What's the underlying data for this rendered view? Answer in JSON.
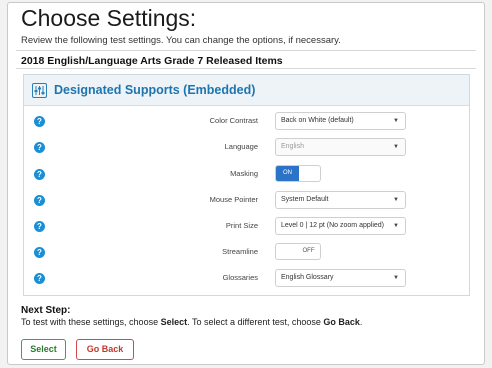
{
  "header": {
    "title": "Choose Settings:",
    "subtitle": "Review the following test settings. You can change the options, if necessary.",
    "test_name": "2018 English/Language Arts Grade 7 Released Items"
  },
  "panel": {
    "title": "Designated Supports (Embedded)",
    "icon": "settings-sliders-icon"
  },
  "settings": [
    {
      "label": "Color Contrast",
      "type": "select",
      "value": "Back on White (default)",
      "disabled": false
    },
    {
      "label": "Language",
      "type": "select",
      "value": "English",
      "disabled": true
    },
    {
      "label": "Masking",
      "type": "toggle",
      "on_label": "ON",
      "state": "on"
    },
    {
      "label": "Mouse Pointer",
      "type": "select",
      "value": "System Default",
      "disabled": false
    },
    {
      "label": "Print Size",
      "type": "select",
      "value": "Level 0 | 12 pt (No zoom applied)",
      "disabled": false
    },
    {
      "label": "Streamline",
      "type": "toggle",
      "off_label": "OFF",
      "state": "off"
    },
    {
      "label": "Glossaries",
      "type": "select",
      "value": "English Glossary",
      "disabled": false
    }
  ],
  "next_step": {
    "heading": "Next Step:",
    "text_1": "To test with these settings, choose ",
    "select_word": "Select",
    "text_2": ". To select a different test, choose ",
    "back_word": "Go Back",
    "text_3": "."
  },
  "buttons": {
    "select_label": "Select",
    "back_label": "Go Back"
  },
  "colors": {
    "accent_blue": "#1d75b0",
    "toggle_on": "#2a73c6",
    "select_green": "#2d7a2d",
    "back_red": "#c0392b"
  }
}
